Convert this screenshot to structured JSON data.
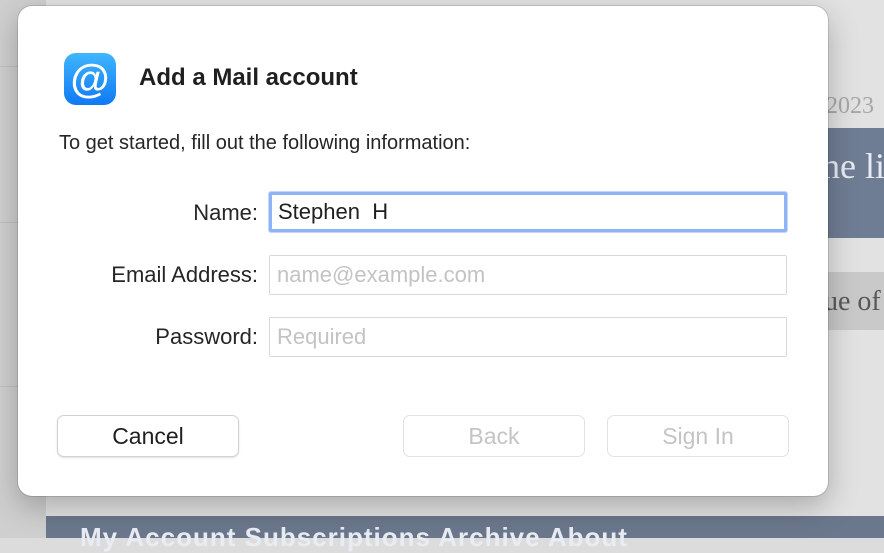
{
  "background": {
    "year_fragment": "2023",
    "hero_fragment": "he li",
    "sub_fragment": "ue of",
    "nav_fragment": "My Account   Subscriptions   Archive   About"
  },
  "dialog": {
    "icon": "at-sign-icon",
    "icon_glyph": "@",
    "title": "Add a Mail account",
    "subtitle": "To get started, fill out the following information:",
    "fields": {
      "name": {
        "label": "Name:",
        "value": "Stephen  H",
        "placeholder": ""
      },
      "email": {
        "label": "Email Address:",
        "value": "",
        "placeholder": "name@example.com"
      },
      "password": {
        "label": "Password:",
        "value": "",
        "placeholder": "Required"
      }
    },
    "buttons": {
      "cancel": "Cancel",
      "back": "Back",
      "sign_in": "Sign In"
    }
  },
  "colors": {
    "accent_focus": "#8fb4f5",
    "icon_gradient_top": "#3fb6ff",
    "icon_gradient_bottom": "#1079f5",
    "disabled_text": "#c4c4c4"
  }
}
